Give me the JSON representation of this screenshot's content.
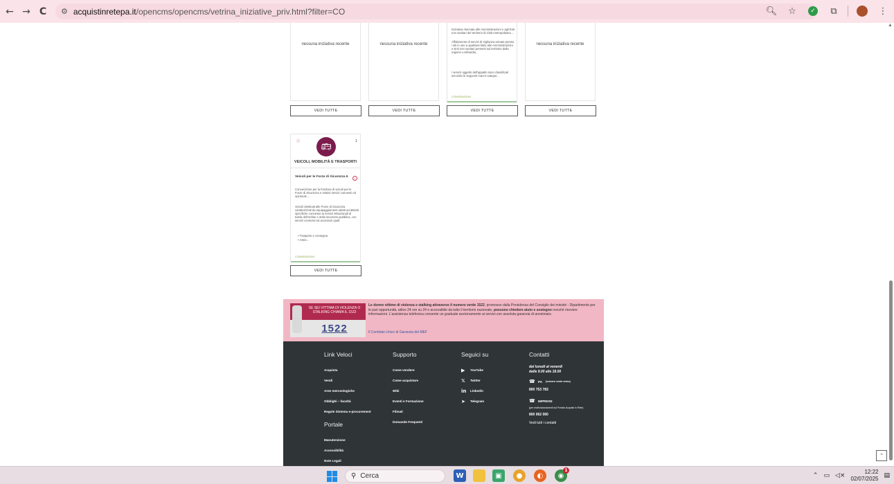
{
  "browser": {
    "url_domain": "acquistinretepa.it",
    "url_path": "/opencms/opencms/vetrina_iniziative_priv.html?filter=CO",
    "back": "←",
    "forward": "→",
    "reload": "C"
  },
  "cards_top": [
    {
      "empty_text": "nessuna iniziativa recente",
      "button": "VEDI TUTTE"
    },
    {
      "empty_text": "nessuna iniziativa recente",
      "button": "VEDI TUTTE"
    },
    {
      "desc1": "Iniziativa riservata alle Amministrazioni e agli Enti non sanitari del territorio di Città metropolitana ...",
      "desc2": "Affidamento di servizi di Vigilanza armata presso i siti in uso a qualsiasi titolo alle Amministrazioni e Enti non sanitari presenti sul territorio della regione Lombardia.",
      "desc3": "I servizi oggetto dell'appalto sono classificati secondo le seguenti macro-categor...",
      "label": "CONVENZIONI",
      "button": "VEDI TUTTE"
    },
    {
      "empty_text": "nessuna iniziativa recente",
      "button": "VEDI TUTTE"
    }
  ],
  "category_card": {
    "star": "☆",
    "count": "1",
    "title": "VEICOLI, MOBILITÀ E TRASPORTI",
    "item_title": "Veicoli per le Forze di Sicurezza 6",
    "desc1": "Convenzione per la fornitura di veicoli per le Forze di Sicurezza e relativi servizi connessi ed opzionali ...",
    "desc2": "Veicoli destinati alle Forze di Sicurezza caratterizzati da equipaggiamenti adatti ad attività specifiche connesse ai servizi istituzionali di tutela dell'ordine e della sicurezza pubblica, con servizi connessi ed accessori quali:",
    "bullets": [
      "Trasporto e consegna",
      "Assis..."
    ],
    "label": "CONVENZIONI",
    "button": "VEDI TUTTE"
  },
  "banner": {
    "img_text": "SE SEI VITTIMA DI VIOLENZA O STALKING CHIAMA IL 1522",
    "number": "1522",
    "text_bold1": "Le donne vittime di violenza e stalking attraverso il numero verde 1522",
    "text_part1": ", promosso dalla Presidenza del Consiglio dei ministri - Dipartimento per le pari opportunità, attivo 24 ore su 24 e accessibile da tutto il territorio nazionale, ",
    "text_bold2": "possono chiedere aiuto e sostegno",
    "text_part2": " nonché ricevere informazioni. L'assistenza telefonica consente un graduale avvicinamento ai servizi con assoluta garanzia di anonimato.",
    "link": "Il Comitato Unico di Garanzia del MEF"
  },
  "footer": {
    "link_veloci": {
      "title": "Link Veloci",
      "items": [
        "Acquista",
        "Vendi",
        "Aree merceologiche",
        "Obblighi – facoltà",
        "Regole Sistema e-procurement"
      ]
    },
    "portale": {
      "title": "Portale",
      "items": [
        "Manutenzione",
        "Accessibilità",
        "Note Legali"
      ]
    },
    "supporto": {
      "title": "Supporto",
      "items": [
        "Come vendere",
        "Come acquistare",
        "Wiki",
        "Eventi e Formazione",
        "Filmati",
        "Domande Frequenti"
      ]
    },
    "seguici": {
      "title": "Seguici su",
      "items": [
        "YouTube",
        "Twitter",
        "Linkedin",
        "Telegram"
      ]
    },
    "contatti": {
      "title": "Contatti",
      "hours1": "dal lunedì al venerdì",
      "hours2": "dalle 9.00 alle 18.00",
      "pa_label": "PA",
      "pa_note": "(numero verde unico)",
      "pa_phone": "800 753 783",
      "imprese_label": "IMPRESE",
      "imprese_note": "(per malfunzionamenti sul Portale Acquisti in Rete)",
      "imprese_phone": "800 062 060",
      "all_contacts": "Vedi tutti i contatti"
    }
  },
  "taskbar": {
    "search": "Cerca",
    "time": "12:22",
    "date": "02/07/2025",
    "notification_count": "1"
  }
}
